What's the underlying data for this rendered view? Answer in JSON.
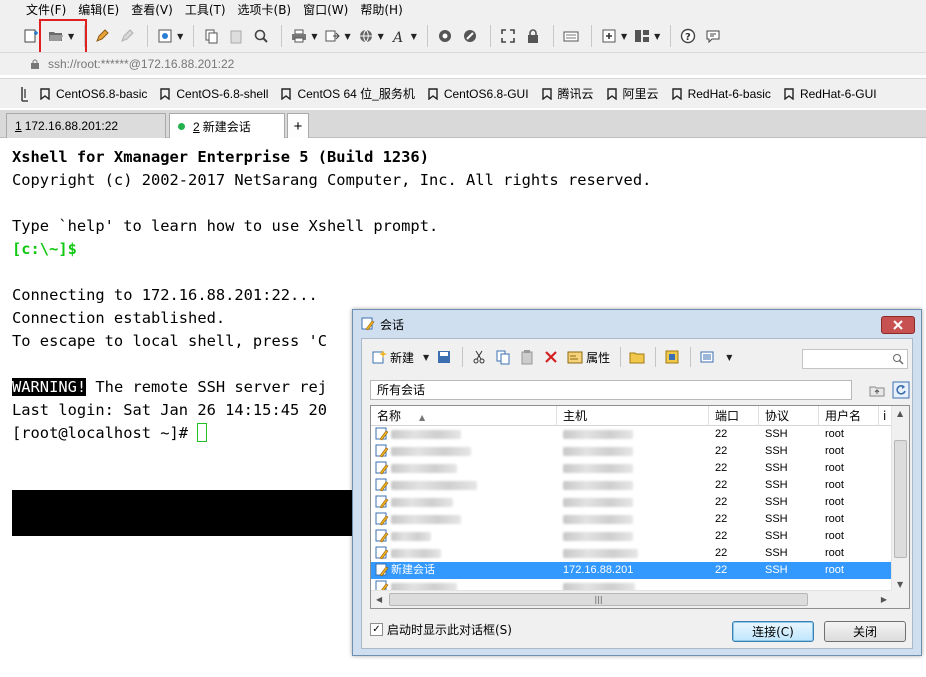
{
  "menu": {
    "items": [
      "文件(F)",
      "编辑(E)",
      "查看(V)",
      "工具(T)",
      "选项卡(B)",
      "窗口(W)",
      "帮助(H)"
    ]
  },
  "toolbar": {
    "icons": [
      "new-session-icon",
      "open-folder-icon",
      "pencil-icon",
      "eraser-icon",
      "settings-icon",
      "copy-icon",
      "paste-icon",
      "find-icon",
      "print-icon",
      "transfer-icon",
      "globe-icon",
      "font-icon",
      "xftp-icon",
      "xmanager-icon",
      "fullscreen-icon",
      "lock-icon",
      "keyboard-icon",
      "add-tab-icon",
      "layout-icon",
      "help-icon",
      "chat-icon"
    ],
    "accent_highlight": "#e02020"
  },
  "address": {
    "text": "ssh://root:******@172.16.88.201:22"
  },
  "links": [
    "CentOS6.8-basic",
    "CentOS-6.8-shell",
    "CentOS 64 位_服务机",
    "CentOS6.8-GUI",
    "腾讯云",
    "阿里云",
    "RedHat-6-basic",
    "RedHat-6-GUI"
  ],
  "tabs": [
    {
      "num": "1",
      "label": "172.16.88.201:22"
    },
    {
      "num": "2",
      "label": "新建会话"
    }
  ],
  "terminal": {
    "line1": "Xshell for Xmanager Enterprise 5 (Build 1236)",
    "line2": "Copyright (c) 2002-2017 NetSarang Computer, Inc. All rights reserved.",
    "line3": "Type `help' to learn how to use Xshell prompt.",
    "prompt_local": "[c:\\~]$",
    "line5": "Connecting to 172.16.88.201:22...",
    "line6": "Connection established.",
    "line7": "To escape to local shell, press 'C",
    "warning_tag": "WARNING!",
    "warning_text": " The remote SSH server rej",
    "last_login": "Last login: Sat Jan 26 14:15:45 20",
    "prompt_remote": "[root@localhost ~]# "
  },
  "dialog": {
    "title": "会话",
    "toolbar": {
      "new_label": "新建",
      "properties_label": "属性"
    },
    "path": "所有会话",
    "columns": {
      "name": "名称",
      "host": "主机",
      "port": "端口",
      "protocol": "协议",
      "user": "用户名",
      "extra": "i"
    },
    "rows": [
      {
        "port": "22",
        "protocol": "SSH",
        "user": "root",
        "name_w": 70,
        "host_w": 70
      },
      {
        "port": "22",
        "protocol": "SSH",
        "user": "root",
        "name_w": 80,
        "host_w": 70
      },
      {
        "port": "22",
        "protocol": "SSH",
        "user": "root",
        "name_w": 66,
        "host_w": 70
      },
      {
        "port": "22",
        "protocol": "SSH",
        "user": "root",
        "name_w": 86,
        "host_w": 70
      },
      {
        "port": "22",
        "protocol": "SSH",
        "user": "root",
        "name_w": 62,
        "host_w": 70
      },
      {
        "port": "22",
        "protocol": "SSH",
        "user": "root",
        "name_w": 70,
        "host_w": 70
      },
      {
        "port": "22",
        "protocol": "SSH",
        "user": "root",
        "name_w": 40,
        "host_w": 70
      },
      {
        "port": "22",
        "protocol": "SSH",
        "user": "root",
        "name_w": 50,
        "host_w": 75
      }
    ],
    "selected_row": {
      "name": "新建会话",
      "host": "172.16.88.201",
      "port": "22",
      "protocol": "SSH",
      "user": "root"
    },
    "startup_checkbox": "启动时显示此对话框(S)",
    "connect_button": "连接(C)",
    "close_button": "关闭"
  }
}
